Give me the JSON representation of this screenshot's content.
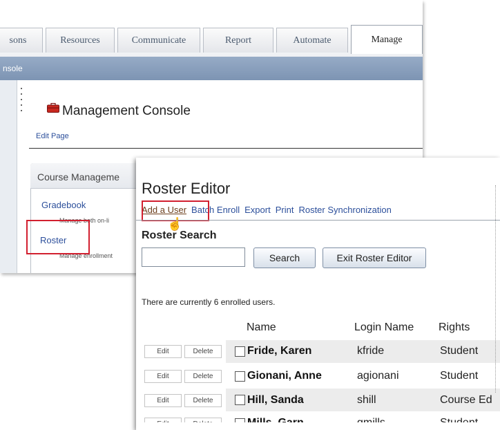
{
  "manage_console": {
    "tabs": [
      "sons",
      "Resources",
      "Communicate",
      "Report",
      "Automate",
      "Manage"
    ],
    "active_tab": "Manage",
    "bar_label": "nsole",
    "title": "Management Console",
    "edit_page": "Edit Page",
    "course_management": {
      "title": "Course Manageme",
      "items": [
        {
          "label": "Gradebook",
          "desc": "Manage both on-li"
        },
        {
          "label": "Roster",
          "desc": "Manage enrollment"
        }
      ]
    },
    "accent_color": "#d21f2f"
  },
  "roster_editor": {
    "title": "Roster Editor",
    "toolbar": [
      "Add a User",
      "Batch Enroll",
      "Export",
      "Print",
      "Roster Synchronization"
    ],
    "search_label": "Roster Search",
    "search_value": "",
    "buttons": {
      "search": "Search",
      "exit": "Exit Roster Editor"
    },
    "enrolled_text": "There are currently 6 enrolled users.",
    "columns": [
      "Name",
      "Login Name",
      "Rights"
    ],
    "row_actions": {
      "edit": "Edit",
      "delete": "Delete"
    },
    "rows": [
      {
        "name": "Fride, Karen",
        "login": "kfride",
        "rights": "Student"
      },
      {
        "name": "Gionani, Anne",
        "login": "agionani",
        "rights": "Student"
      },
      {
        "name": "Hill, Sanda",
        "login": "shill",
        "rights": "Course Ed"
      },
      {
        "name": "Mills, Garn",
        "login": "gmills",
        "rights": "Student"
      }
    ]
  }
}
